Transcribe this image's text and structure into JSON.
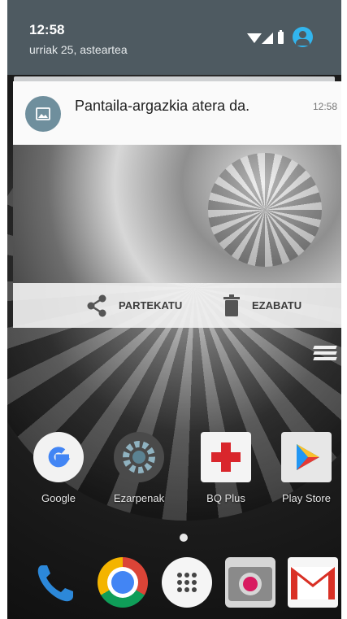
{
  "status_bar": {
    "time": "12:58",
    "date": "urriak 25, asteartea"
  },
  "notification": {
    "title": "Pantaila-argazkia atera da.",
    "time": "12:58",
    "actions": [
      {
        "label": "PARTEKATU",
        "icon": "share-icon"
      },
      {
        "label": "EZABATU",
        "icon": "trash-icon"
      }
    ]
  },
  "home_apps": [
    {
      "label": "Google",
      "icon": "google-icon"
    },
    {
      "label": "Ezarpenak",
      "icon": "gear-icon"
    },
    {
      "label": "BQ Plus",
      "icon": "plus-icon"
    },
    {
      "label": "Play Store",
      "icon": "play-store-icon"
    }
  ],
  "dock": [
    {
      "icon": "phone-icon"
    },
    {
      "icon": "chrome-icon"
    },
    {
      "icon": "app-drawer-icon"
    },
    {
      "icon": "camera-icon"
    },
    {
      "icon": "gmail-icon"
    }
  ],
  "colors": {
    "status_bar": "#4e5a61",
    "accent": "#32b5ee",
    "notification_icon_bg": "#6f8f9d"
  }
}
